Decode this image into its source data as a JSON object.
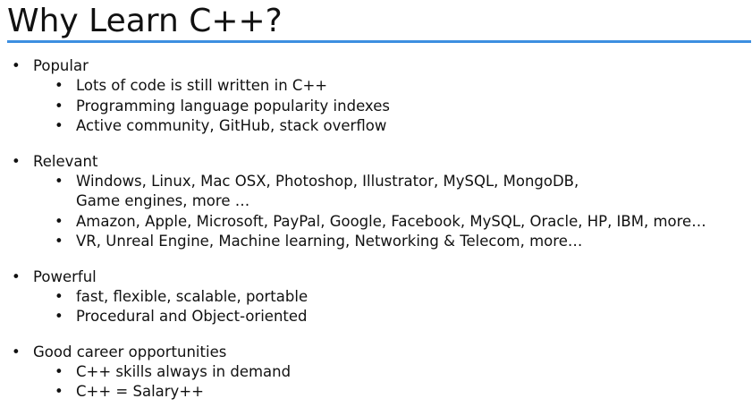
{
  "slide": {
    "title": "Why Learn C++?",
    "accent_color": "#3d8fe0",
    "bullet_glyph": "•",
    "sections": [
      {
        "heading": "Popular",
        "items": [
          [
            "Lots of code is still written in C++"
          ],
          [
            "Programming language popularity indexes"
          ],
          [
            "Active community, GitHub, stack overflow"
          ]
        ]
      },
      {
        "heading": "Relevant",
        "items": [
          [
            "Windows, Linux, Mac OSX, Photoshop, Illustrator, MySQL, MongoDB,",
            "Game engines, more …"
          ],
          [
            "Amazon, Apple, Microsoft, PayPal, Google, Facebook, MySQL,  Oracle, HP, IBM, more…"
          ],
          [
            "VR, Unreal Engine, Machine learning, Networking & Telecom, more…"
          ]
        ]
      },
      {
        "heading": "Powerful",
        "items": [
          [
            "fast, flexible, scalable, portable"
          ],
          [
            "Procedural and Object-oriented"
          ]
        ]
      },
      {
        "heading": "Good career opportunities",
        "items": [
          [
            "C++ skills always in demand"
          ],
          [
            "C++ = Salary++"
          ]
        ]
      }
    ]
  }
}
